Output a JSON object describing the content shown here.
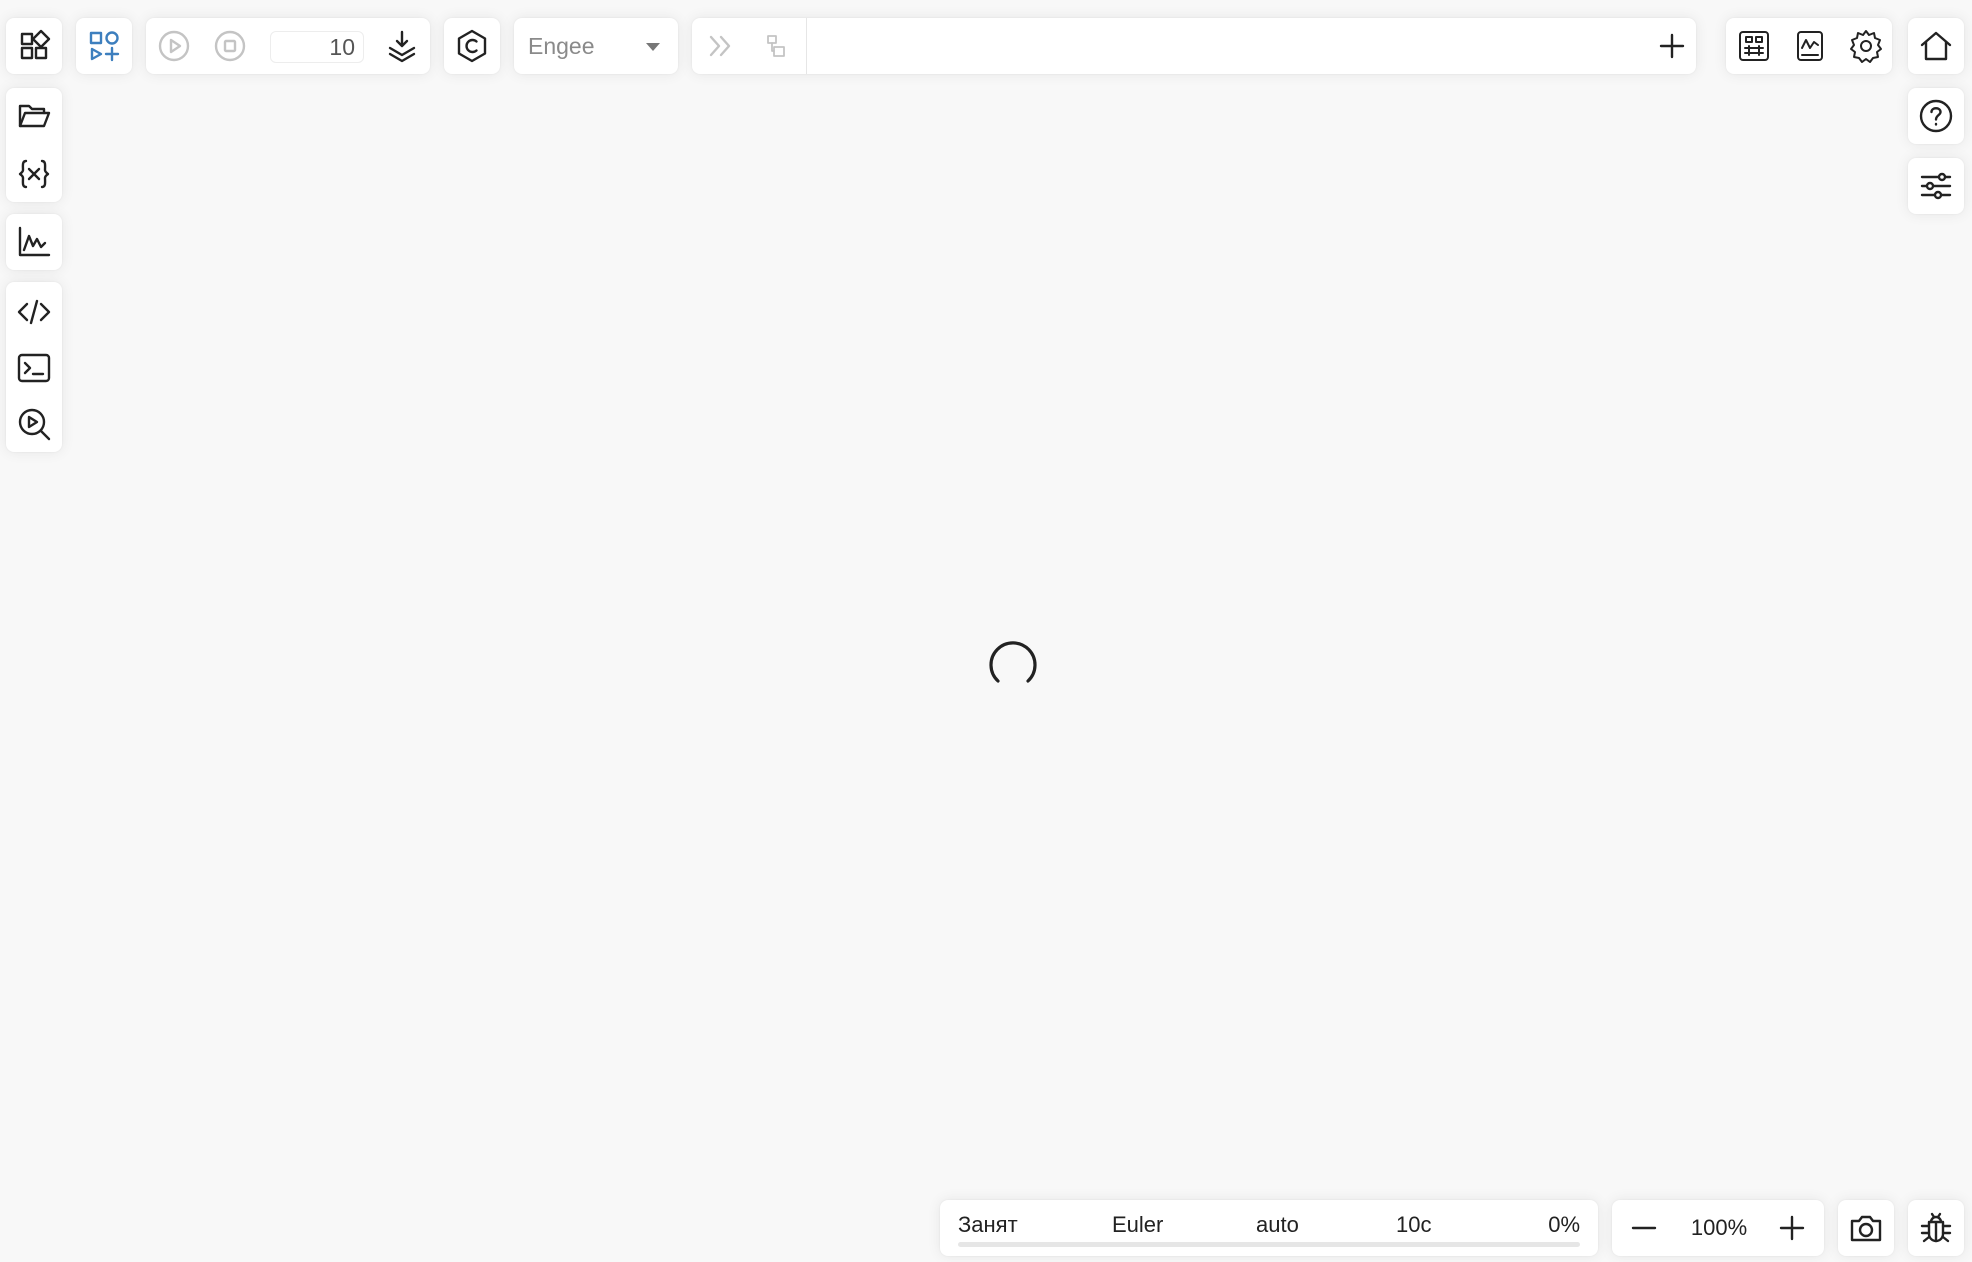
{
  "toolbar": {
    "sim_steps_value": "10",
    "solver_selected": "Engee",
    "icons": {
      "blocks_library": "blocks-library-icon",
      "add_block": "add-block-icon",
      "run": "play-icon",
      "stop": "stop-icon",
      "step_download": "step-download-icon",
      "codegen": "codegen-icon",
      "forward": "chevron-double-right-icon",
      "subsystem": "subsystem-icon",
      "add_tab": "plus-icon",
      "signal_panel": "signal-panel-icon",
      "graphs": "graphs-icon",
      "settings": "gear-icon",
      "home": "home-icon"
    }
  },
  "left_sidebar": {
    "icons": [
      "folder-open-icon",
      "variables-icon",
      "chart-icon",
      "code-icon",
      "terminal-icon",
      "search-zoom-icon"
    ]
  },
  "right_sidebar": {
    "icons": [
      "help-icon",
      "sliders-icon"
    ]
  },
  "status": {
    "state": "Занят",
    "solver": "Euler",
    "step": "auto",
    "time": "10с",
    "progress_text": "0%",
    "progress": 0
  },
  "zoom": {
    "value": "100%"
  },
  "colors": {
    "accent": "#3d7fbe",
    "background": "#f8f8f8",
    "panel": "#ffffff",
    "icon": "#222222",
    "icon_disabled": "#c4c4c4"
  }
}
